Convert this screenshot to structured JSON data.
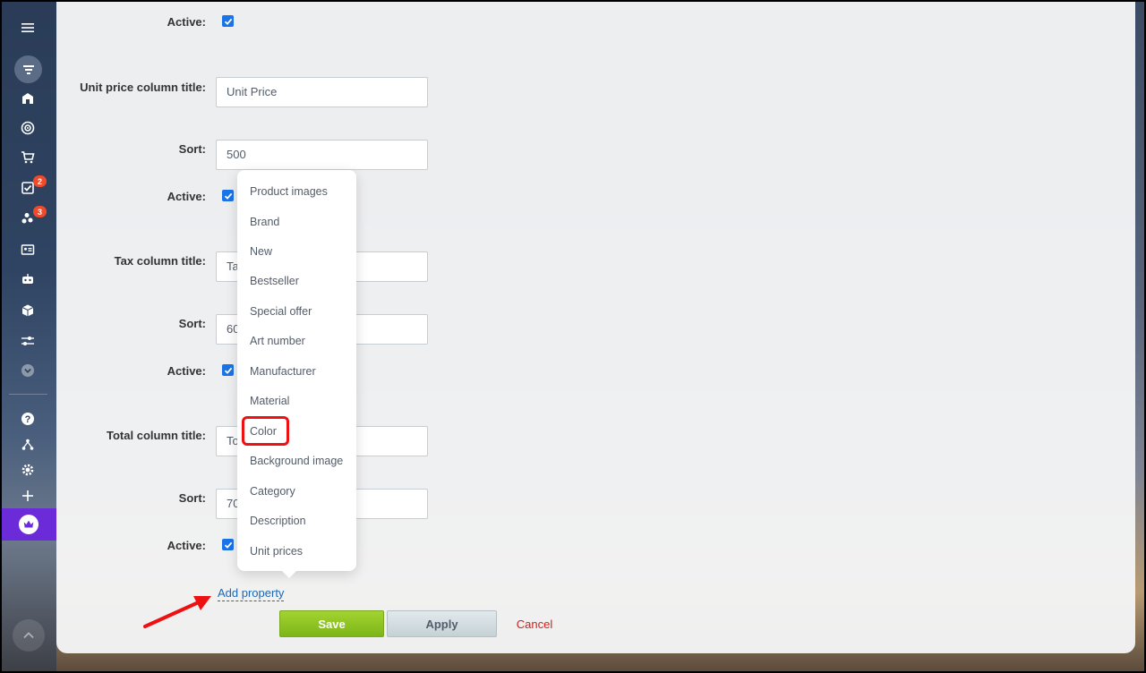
{
  "sidebar": {
    "badges": {
      "tasks": "2",
      "chats": "3"
    }
  },
  "form": {
    "rows": [
      {
        "label": "Active:",
        "kind": "checkbox",
        "checked": true
      },
      {
        "label": "Unit price column title:",
        "kind": "input",
        "value": "Unit Price"
      },
      {
        "label": "Sort:",
        "kind": "input",
        "value": "500"
      },
      {
        "label": "Active:",
        "kind": "checkbox",
        "checked": true
      },
      {
        "label": "Tax column title:",
        "kind": "input",
        "value": "Tax"
      },
      {
        "label": "Sort:",
        "kind": "input",
        "value": "600"
      },
      {
        "label": "Active:",
        "kind": "checkbox",
        "checked": true
      },
      {
        "label": "Total column title:",
        "kind": "input",
        "value": "Total"
      },
      {
        "label": "Sort:",
        "kind": "input",
        "value": "700"
      },
      {
        "label": "Active:",
        "kind": "checkbox",
        "checked": true
      }
    ],
    "add_property": "Add property"
  },
  "property_menu": {
    "items": [
      "Product images",
      "Brand",
      "New",
      "Bestseller",
      "Special offer",
      "Art number",
      "Manufacturer",
      "Material",
      "Color",
      "Background image",
      "Category",
      "Description",
      "Unit prices"
    ],
    "highlighted": "Color"
  },
  "buttons": {
    "save": "Save",
    "apply": "Apply",
    "cancel": "Cancel"
  },
  "colors": {
    "save_green": "#8cc425",
    "link_blue": "#2067b0",
    "cancel_red": "#cc1f1f",
    "highlight_red": "#ee1111"
  }
}
